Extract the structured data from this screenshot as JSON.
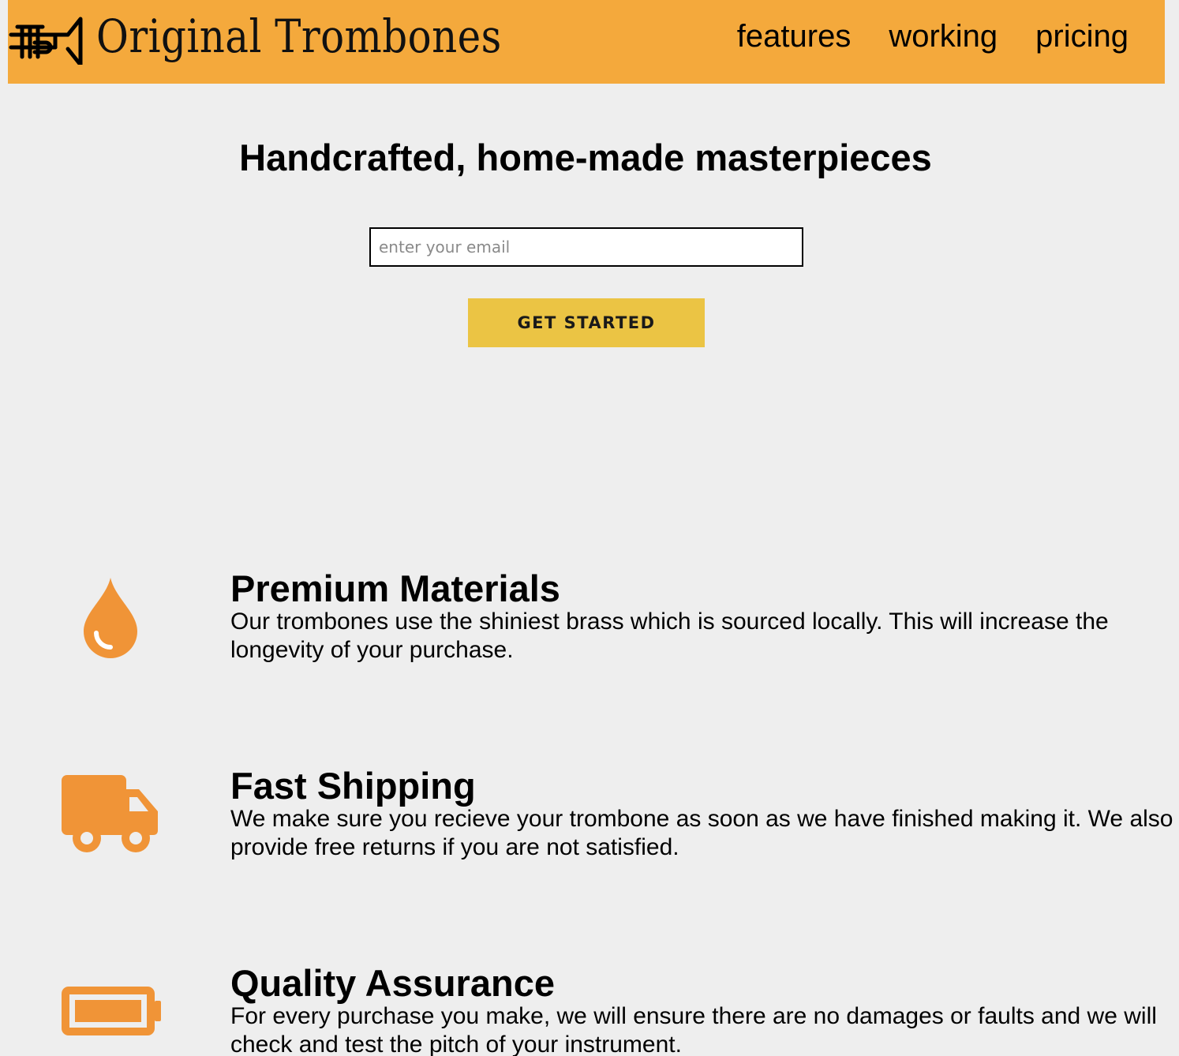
{
  "header": {
    "brand": "Original Trombones",
    "logo_icon": "trombone-logo-icon",
    "nav": [
      {
        "label": "features"
      },
      {
        "label": "working"
      },
      {
        "label": "pricing"
      }
    ]
  },
  "hero": {
    "title": "Handcrafted, home-made masterpieces",
    "email_placeholder": "enter your email",
    "email_value": "",
    "cta_label": "GET STARTED"
  },
  "features": [
    {
      "icon": "drop-icon",
      "title": "Premium Materials",
      "description": "Our trombones use the shiniest brass which is sourced locally. This will increase the longevity of your purchase."
    },
    {
      "icon": "truck-icon",
      "title": "Fast Shipping",
      "description": "We make sure you recieve your trombone as soon as we have finished making it. We also provide free returns if you are not satisfied."
    },
    {
      "icon": "battery-icon",
      "title": "Quality Assurance",
      "description": "For every purchase you make, we will ensure there are no damages or faults and we will check and test the pitch of your instrument."
    }
  ],
  "colors": {
    "header_bg": "#f4a93c",
    "cta_bg": "#ebc444",
    "icon_orange": "#f09437",
    "page_bg": "#eeeeee"
  }
}
